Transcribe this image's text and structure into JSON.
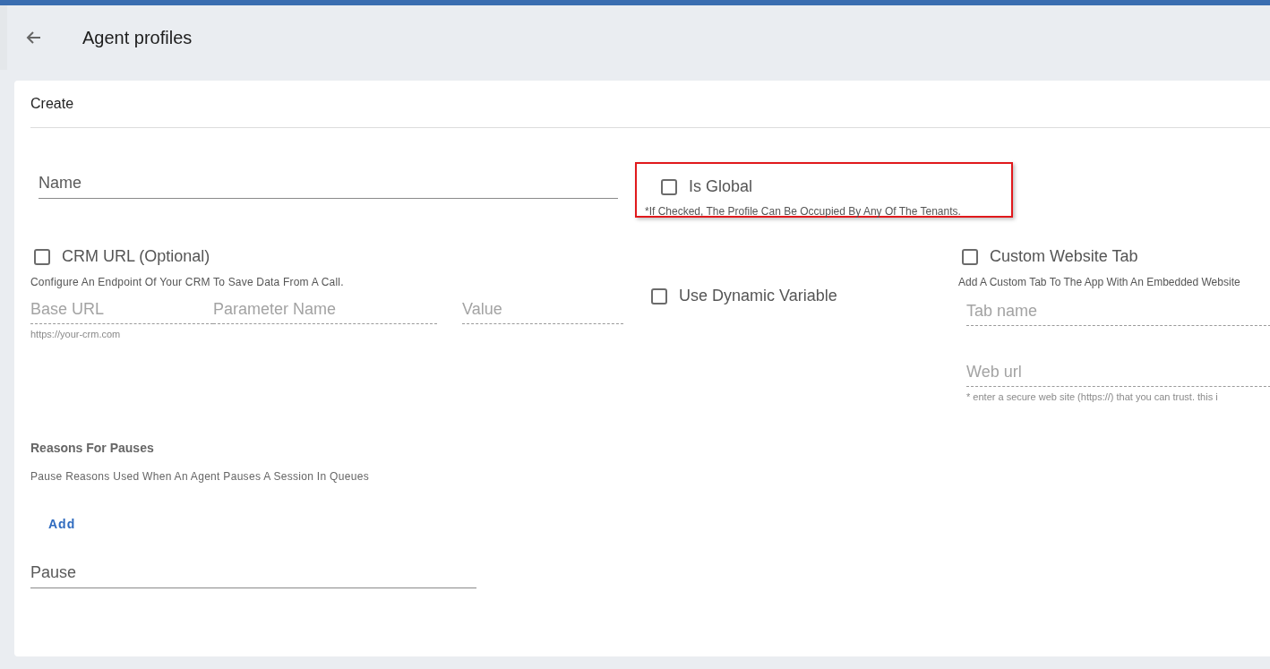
{
  "header": {
    "title": "Agent profiles"
  },
  "card": {
    "title": "Create"
  },
  "name_field": {
    "placeholder": "Name",
    "disabled": false
  },
  "is_global": {
    "label": "Is Global",
    "checked": false,
    "hint": "*If Checked, The Profile Can Be Occupied By Any Of The Tenants.",
    "highlighted": true
  },
  "crm": {
    "label": "CRM URL (Optional)",
    "checked": false,
    "description": "Configure An Endpoint Of Your CRM To Save Data From A Call.",
    "fields": [
      {
        "placeholder": "Base URL",
        "hint": "https://your-crm.com",
        "disabled": true
      },
      {
        "placeholder": "Parameter Name",
        "disabled": true
      },
      {
        "placeholder": "Value",
        "disabled": true
      }
    ]
  },
  "dynamic_variable": {
    "label": "Use Dynamic Variable",
    "checked": false
  },
  "custom_tab": {
    "label": "Custom Website Tab",
    "checked": false,
    "description": "Add A Custom Tab To The App With An Embedded Website",
    "fields": [
      {
        "placeholder": "Tab name",
        "disabled": true
      },
      {
        "placeholder": "Web url",
        "hint": "* enter a secure web site (https://) that you can trust. this i",
        "disabled": true
      }
    ]
  },
  "pauses": {
    "title": "Reasons For Pauses",
    "description": "Pause Reasons Used When An Agent Pauses A Session In Queues",
    "add_button": "Add",
    "fields": [
      {
        "placeholder": "Pause",
        "disabled": false
      }
    ]
  }
}
